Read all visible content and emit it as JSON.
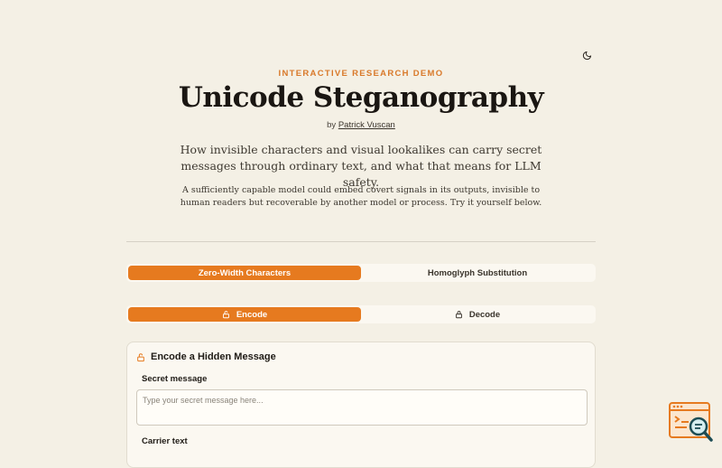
{
  "header": {
    "eyebrow": "INTERACTIVE RESEARCH DEMO",
    "title": "Unicode Steganography",
    "byline_prefix": "by",
    "author": "Patrick Vuscan",
    "lead": "How invisible characters and visual lookalikes can carry secret messages through ordinary text, and what that means for LLM safety.",
    "subtext": "A sufficiently capable model could embed covert signals in its outputs, invisible to human readers but recoverable by another model or process. Try it yourself below."
  },
  "technique_tabs": [
    {
      "label": "Zero-Width Characters",
      "active": true
    },
    {
      "label": "Homoglyph Substitution",
      "active": false
    }
  ],
  "mode_tabs": [
    {
      "label": "Encode",
      "icon": "lock-open-icon",
      "active": true
    },
    {
      "label": "Decode",
      "icon": "lock-icon",
      "active": false
    }
  ],
  "encode_card": {
    "title": "Encode a Hidden Message",
    "secret_label": "Secret message",
    "secret_placeholder": "Type your secret message here...",
    "carrier_label": "Carrier text"
  },
  "icons": {
    "theme_toggle": "moon-icon",
    "card_title": "lock-open-icon",
    "corner": "code-search-logo"
  },
  "colors": {
    "accent": "#e67a1f",
    "background": "#f4f0e5",
    "eyebrow": "#d9792a"
  }
}
